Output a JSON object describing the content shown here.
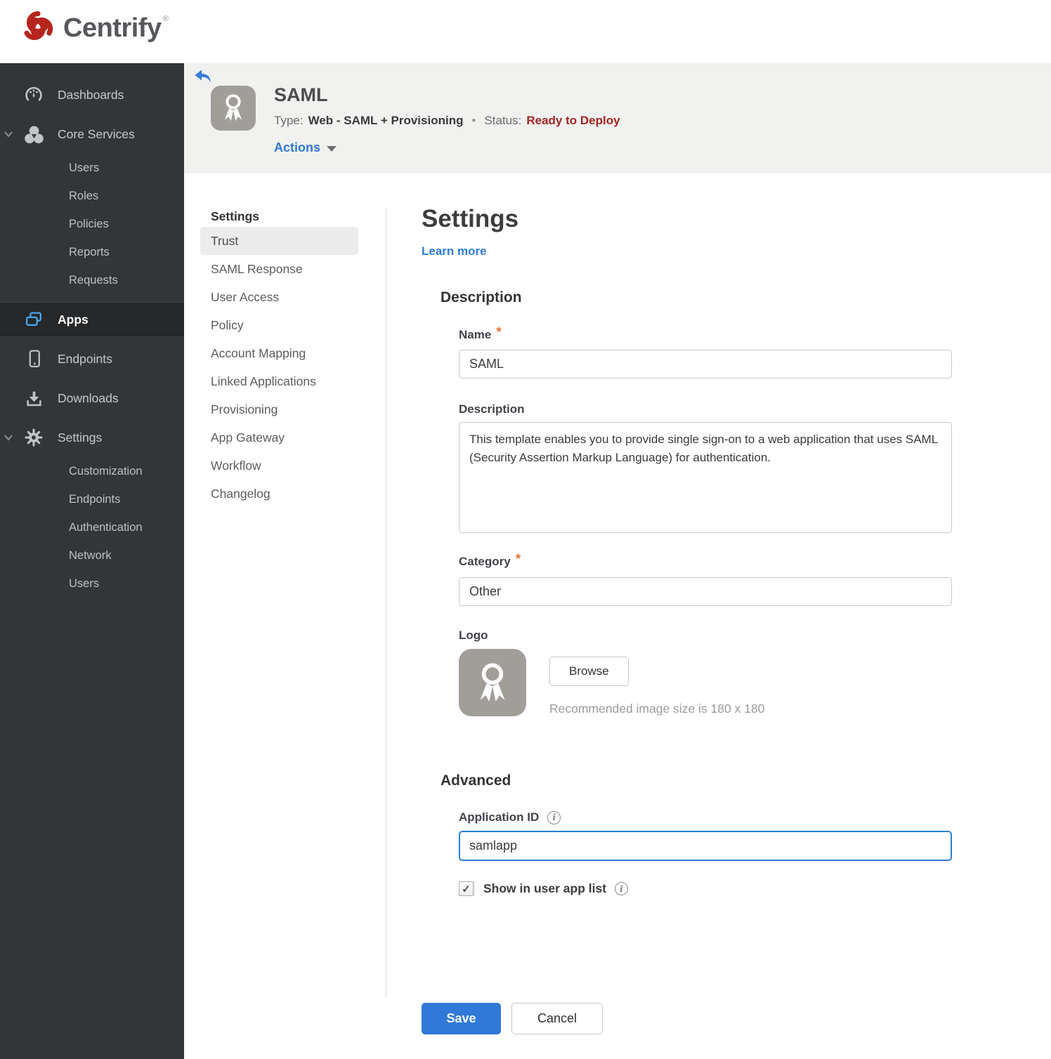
{
  "brand": {
    "name": "Centrify",
    "trademark": "®"
  },
  "sidebar": {
    "dashboards": "Dashboards",
    "core_services": "Core Services",
    "core_children": [
      "Users",
      "Roles",
      "Policies",
      "Reports",
      "Requests"
    ],
    "apps": "Apps",
    "endpoints": "Endpoints",
    "downloads": "Downloads",
    "settings": "Settings",
    "settings_children": [
      "Customization",
      "Endpoints",
      "Authentication",
      "Network",
      "Users"
    ]
  },
  "header": {
    "app_title": "SAML",
    "type_label": "Type:",
    "type_value": "Web - SAML + Provisioning",
    "separator": "•",
    "status_label": "Status:",
    "status_value": "Ready to Deploy",
    "actions_label": "Actions"
  },
  "subnav": {
    "heading": "Settings",
    "active_item": "Trust",
    "items": [
      "Trust",
      "SAML Response",
      "User Access",
      "Policy",
      "Account Mapping",
      "Linked Applications",
      "Provisioning",
      "App Gateway",
      "Workflow",
      "Changelog"
    ]
  },
  "main": {
    "title": "Settings",
    "learn_more": "Learn more",
    "description": {
      "heading": "Description",
      "name_label": "Name",
      "required_mark": "*",
      "name_value": "SAML",
      "description_label": "Description",
      "description_value": "This template enables you to provide single sign-on to a web application that uses SAML (Security Assertion Markup Language) for authentication.",
      "category_label": "Category",
      "category_value": "Other",
      "logo_label": "Logo",
      "browse_label": "Browse",
      "logo_hint": "Recommended image size is 180 x 180"
    },
    "advanced": {
      "heading": "Advanced",
      "app_id_label": "Application ID",
      "app_id_value": "samlapp",
      "show_in_list_label": "Show in user app list",
      "checkbox_checked": true
    },
    "save_label": "Save",
    "cancel_label": "Cancel"
  },
  "icons": {
    "info": "i",
    "check": "✓"
  },
  "colors": {
    "accent_blue": "#3079d8",
    "link_blue": "#2e7cd9",
    "status_red": "#a42721",
    "sidebar_bg": "#333537",
    "sidebar_active_bg": "#26282a",
    "banner_bg": "#f1f1f0",
    "apps_icon_blue": "#49a4e9",
    "asterisk_orange": "#e4713a",
    "logo_gray": "#a19e9a",
    "brand_red": "#b5251d"
  }
}
